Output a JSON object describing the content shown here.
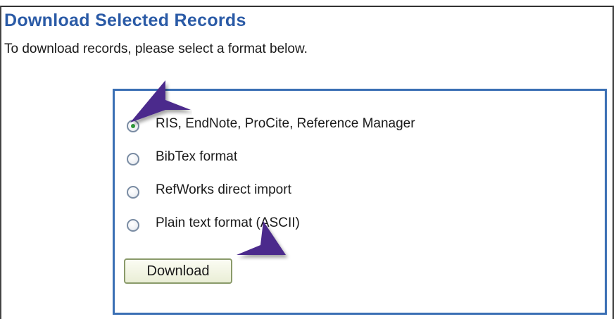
{
  "header": {
    "title": "Download Selected Records",
    "instructions": "To download records, please select a format below."
  },
  "format_options": [
    {
      "label": "RIS, EndNote, ProCite, Reference Manager",
      "selected": true
    },
    {
      "label": "BibTex format",
      "selected": false
    },
    {
      "label": "RefWorks direct import",
      "selected": false
    },
    {
      "label": "Plain text format (ASCII)",
      "selected": false
    }
  ],
  "actions": {
    "download_label": "Download"
  },
  "colors": {
    "title": "#2a5aa6",
    "box_border": "#3a6fb4",
    "arrow": "#4b2a8c",
    "radio_checked": "#2f9a3a"
  },
  "icons": {
    "pointer": "annotation-arrow-icon"
  }
}
